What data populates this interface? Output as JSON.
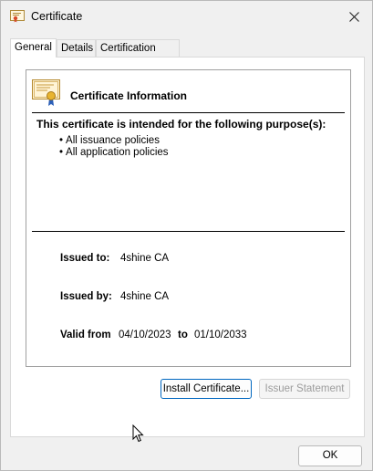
{
  "window": {
    "title": "Certificate",
    "close_glyph": "✕"
  },
  "tabs": [
    {
      "label": "General",
      "active": true
    },
    {
      "label": "Details",
      "active": false
    },
    {
      "label": "Certification Path",
      "active": false
    }
  ],
  "info": {
    "title": "Certificate Information",
    "purpose_heading": "This certificate is intended for the following purpose(s):",
    "policies": [
      "All issuance policies",
      "All application policies"
    ]
  },
  "issued_to": {
    "label": "Issued to:",
    "value": "4shine CA"
  },
  "issued_by": {
    "label": "Issued by:",
    "value": "4shine CA"
  },
  "validity": {
    "label": "Valid from",
    "from": "04/10/2023",
    "to_label": "to",
    "to": "01/10/2033"
  },
  "buttons": {
    "install": "Install Certificate...",
    "issuer_statement": "Issuer Statement",
    "ok": "OK"
  },
  "icons": {
    "app": "certificate-icon",
    "close": "close-icon",
    "cert_large": "certificate-ribbon-icon",
    "cursor": "mouse-pointer-icon"
  },
  "colors": {
    "accent": "#0067c0",
    "disabled_text": "#9c9c9c"
  }
}
